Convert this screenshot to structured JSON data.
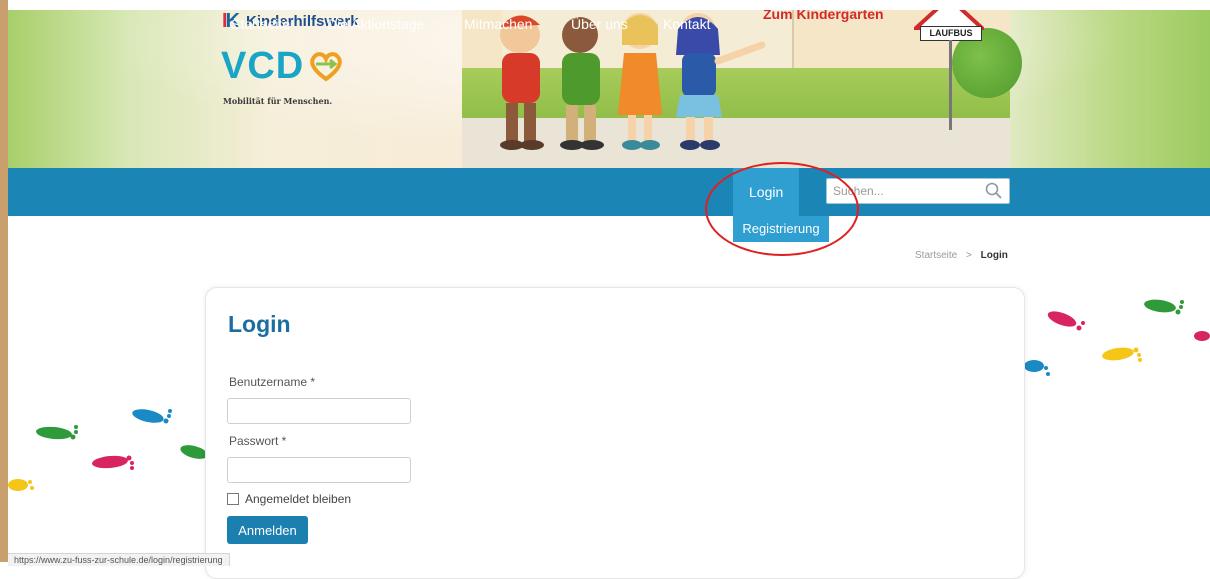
{
  "header": {
    "partner_logo_text": "Kinderhilfswerk",
    "vcd_logo_text": "VCD",
    "vcd_tagline": "Mobilität für Menschen.",
    "illustration_headline": "Zum Kindergarten",
    "sign_text": "LAUFBUS"
  },
  "nav": {
    "items": [
      {
        "label": "Startseite"
      },
      {
        "label": "Die Aktionstage"
      },
      {
        "label": "Mitmachen"
      },
      {
        "label": "Über uns"
      },
      {
        "label": "Kontakt"
      },
      {
        "label": "Login"
      }
    ],
    "search_placeholder": "Suchen...",
    "dropdown_item": "Registrierung"
  },
  "breadcrumb": {
    "home": "Startseite",
    "separator": ">",
    "current": "Login"
  },
  "login": {
    "title": "Login",
    "username_label": "Benutzername *",
    "username_value": "",
    "password_label": "Passwort *",
    "password_value": "",
    "remember_label": "Angemeldet bleiben",
    "submit_label": "Anmelden"
  },
  "status_url": "https://www.zu-fuss-zur-schule.de/login/registrierung",
  "colors": {
    "nav_bg": "#1b85b5",
    "nav_active": "#2f9ed0",
    "title_blue": "#1c6ea0",
    "annotation_red": "#e02020"
  }
}
